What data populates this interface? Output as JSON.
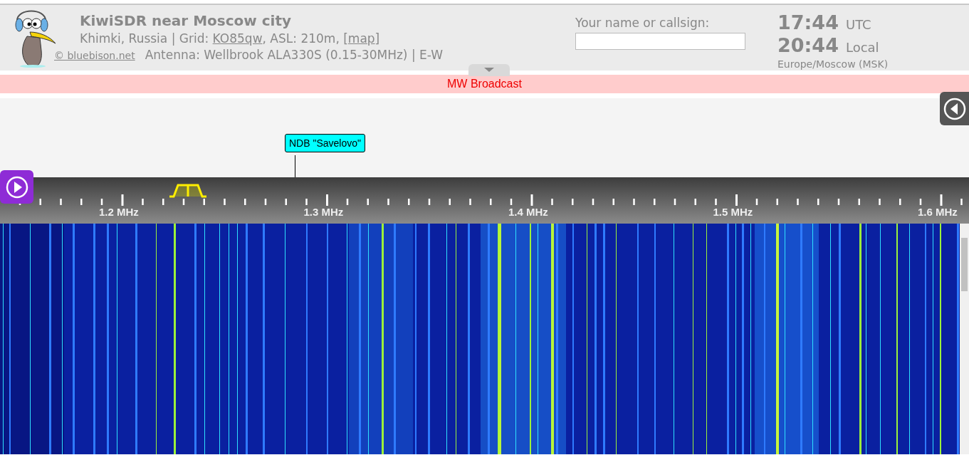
{
  "header": {
    "title": "KiwiSDR near Moscow city",
    "location": {
      "prefix": "Khimki, Russia | Grid: ",
      "grid_link": "KO85qw",
      "middle": ", ASL: 210m, [",
      "map_link": "map",
      "suffix": "]"
    },
    "credit_link": "© bluebison.net",
    "antenna": "Antenna: Wellbrook ALA330S (0.15-30MHz) | E-W",
    "callsign": {
      "label": "Your name or callsign:"
    },
    "clocks": [
      {
        "time": "17:44",
        "zone": "UTC"
      },
      {
        "time": "20:44",
        "zone": "Local"
      }
    ],
    "timezone": "Europe/Moscow (MSK)"
  },
  "band_bar": {
    "label": "MW Broadcast"
  },
  "station_label": {
    "text": "NDB \"Savelovo\""
  },
  "scale": {
    "labels": [
      "1.2 MHz",
      "1.3 MHz",
      "1.4 MHz",
      "1.5 MHz",
      "1.6 MHz"
    ]
  }
}
